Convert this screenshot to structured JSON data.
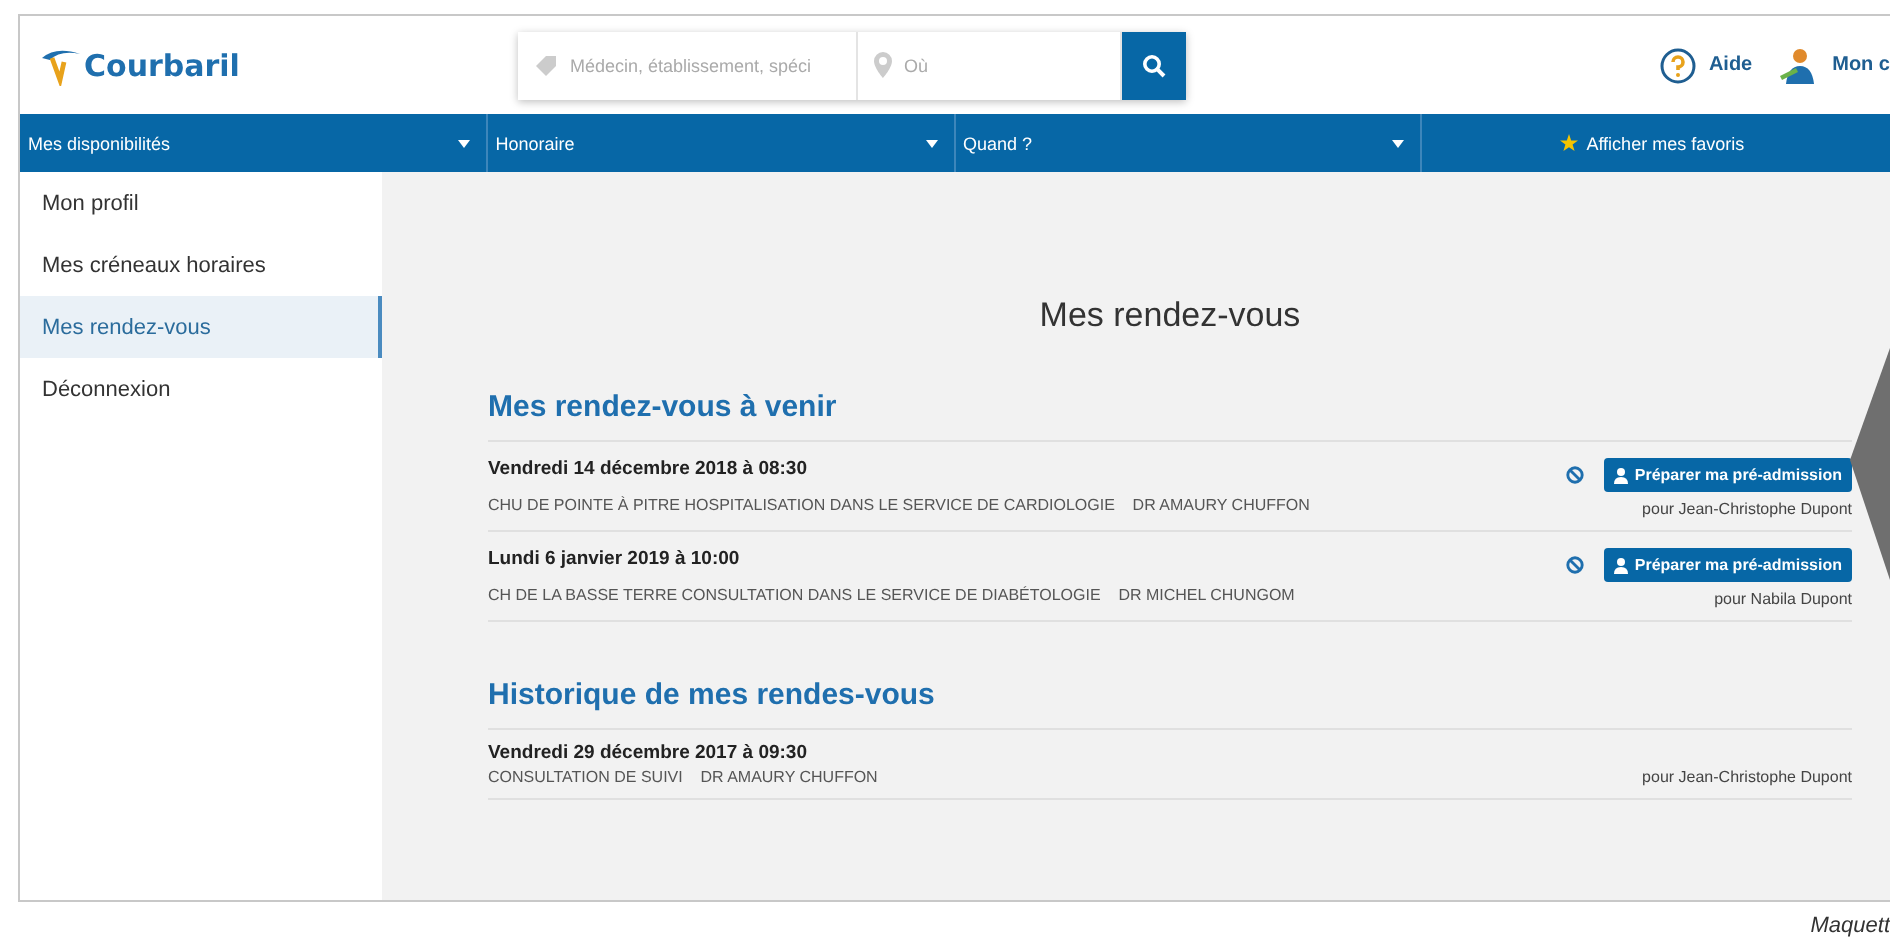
{
  "header": {
    "logo": "Courbaril",
    "search": {
      "placeholder": "Médecin, établissement, spéci",
      "location_placeholder": "Où"
    },
    "links": [
      {
        "label": "Aide",
        "kind": "help"
      },
      {
        "label": "Mon c",
        "kind": "account"
      }
    ]
  },
  "nav": [
    {
      "label": "Mes disponibilités",
      "kind": "dropdown"
    },
    {
      "label": "Honoraire",
      "kind": "dropdown"
    },
    {
      "label": "Quand ?",
      "kind": "dropdown"
    },
    {
      "label": "Afficher mes favoris",
      "kind": "favorites"
    }
  ],
  "sidebar": {
    "items": [
      {
        "label": "Mon profil",
        "selected": false
      },
      {
        "label": "Mes créneaux horaires",
        "selected": false
      },
      {
        "label": "Mes rendez-vous",
        "selected": true
      },
      {
        "label": "Déconnexion",
        "selected": false
      }
    ]
  },
  "title": "Mes rendez-vous",
  "sections": [
    {
      "title": "Mes rendez-vous à venir",
      "appointments": [
        {
          "date": "Vendredi 14 décembre 2018 à 08:30",
          "place": "CHU DE POINTE À PITRE HOSPITALISATION DANS LE SERVICE DE CARDIOLOGIE",
          "doctor": "DR AMAURY CHUFFON",
          "patient": "pour Jean-Christophe Dupont",
          "cancelable": true,
          "action": "Préparer ma pré-admission"
        },
        {
          "date": "Lundi 6 janvier 2019 à 10:00",
          "place": "CH DE LA BASSE TERRE CONSULTATION DANS LE SERVICE DE DIABÉTOLOGIE",
          "doctor": "DR MICHEL CHUNGOM",
          "patient": "pour Nabila Dupont",
          "cancelable": true,
          "action": "Préparer ma pré-admission"
        }
      ]
    },
    {
      "title": "Historique de mes rendes-vous",
      "appointments": [
        {
          "date": "Vendredi 29 décembre 2017 à 09:30",
          "place": "CONSULTATION DE SUIVI",
          "doctor": "DR AMAURY CHUFFON",
          "patient": "pour Jean-Christophe Dupont",
          "cancelable": false
        }
      ]
    }
  ],
  "caption": "Maquett"
}
